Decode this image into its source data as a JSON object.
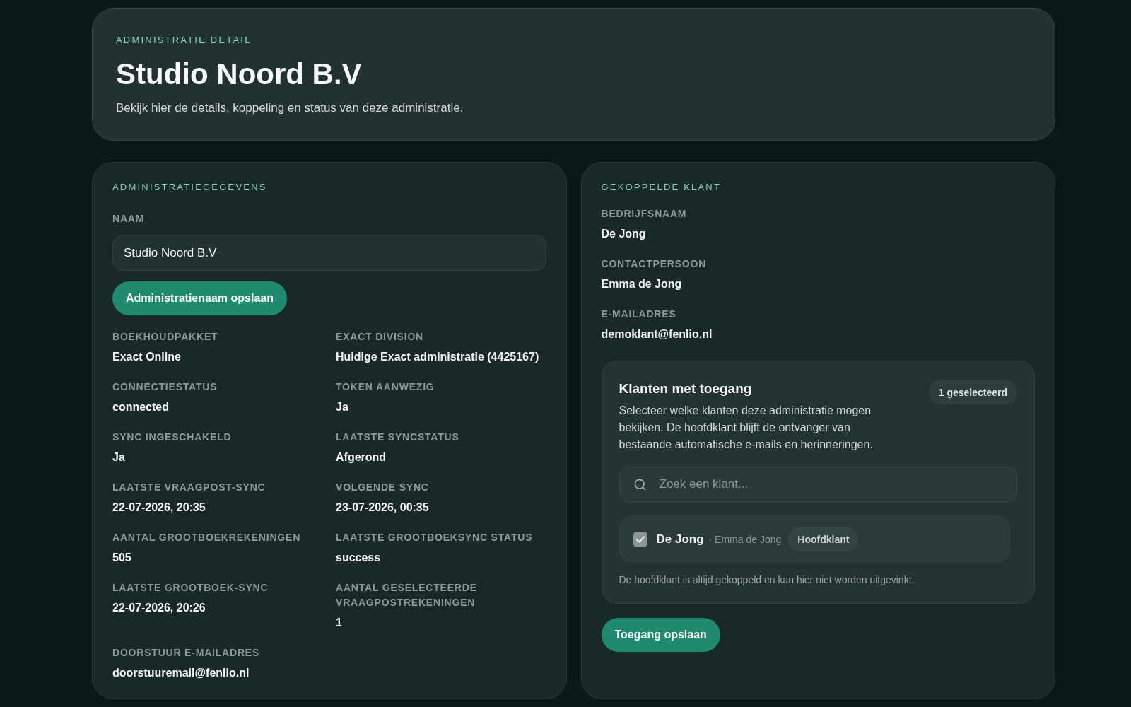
{
  "header": {
    "eyebrow": "ADMINISTRATIE DETAIL",
    "title": "Studio Noord B.V",
    "subtitle": "Bekijk hier de details, koppeling en status van deze administratie."
  },
  "administration": {
    "heading": "ADMINISTRATIEGEGEVENS",
    "name_label": "NAAM",
    "name_value": "Studio Noord B.V",
    "save_button": "Administratienaam opslaan",
    "fields": [
      {
        "label": "BOEKHOUDPAKKET",
        "value": "Exact Online"
      },
      {
        "label": "EXACT DIVISION",
        "value": "Huidige Exact administratie (4425167)"
      },
      {
        "label": "CONNECTIESTATUS",
        "value": "connected"
      },
      {
        "label": "TOKEN AANWEZIG",
        "value": "Ja"
      },
      {
        "label": "SYNC INGESCHAKELD",
        "value": "Ja"
      },
      {
        "label": "LAATSTE SYNCSTATUS",
        "value": "Afgerond"
      },
      {
        "label": "LAATSTE VRAAGPOST-SYNC",
        "value": "22-07-2026, 20:35"
      },
      {
        "label": "VOLGENDE SYNC",
        "value": "23-07-2026, 00:35"
      },
      {
        "label": "AANTAL GROOTBOEKREKENINGEN",
        "value": "505"
      },
      {
        "label": "LAATSTE GROOTBOEKSYNC STATUS",
        "value": "success"
      },
      {
        "label": "LAATSTE GROOTBOEK-SYNC",
        "value": "22-07-2026, 20:26"
      },
      {
        "label": "AANTAL GESELECTEERDE VRAAGPOSTREKENINGEN",
        "value": "1"
      },
      {
        "label": "DOORSTUUR E-MAILADRES",
        "value": "doorstuuremail@fenlio.nl"
      }
    ]
  },
  "linked_client": {
    "heading": "GEKOPPELDE KLANT",
    "fields": [
      {
        "label": "BEDRIJFSNAAM",
        "value": "De Jong"
      },
      {
        "label": "CONTACTPERSOON",
        "value": "Emma de Jong"
      },
      {
        "label": "E-MAILADRES",
        "value": "demoklant@fenlio.nl"
      }
    ],
    "access": {
      "title": "Klanten met toegang",
      "badge": "1 geselecteerd",
      "description": "Selecteer welke klanten deze administratie mogen bekijken. De hoofdklant blijft de ontvanger van bestaande automatische e-mails en herinneringen.",
      "search": {
        "placeholder": "Zoek een klant..."
      },
      "clients": [
        {
          "name": "De Jong",
          "contact": "· Emma de Jong",
          "tag": "Hoofdklant",
          "checked": true,
          "disabled": true
        }
      ],
      "note": "De hoofdklant is altijd gekoppeld en kan hier niet worden uitgevinkt."
    },
    "save_button": "Toegang opslaan"
  }
}
